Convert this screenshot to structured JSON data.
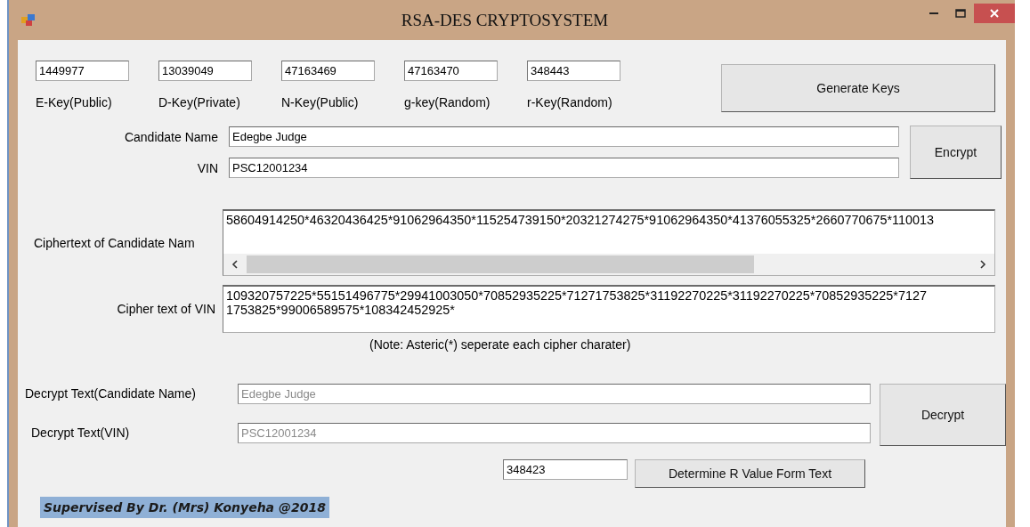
{
  "window": {
    "title": "RSA-DES CRYPTOSYSTEM"
  },
  "keys": [
    {
      "value": "1449977",
      "label": "E-Key(Public)"
    },
    {
      "value": "13039049",
      "label": "D-Key(Private)"
    },
    {
      "value": "47163469",
      "label": "N-Key(Public)"
    },
    {
      "value": "47163470",
      "label": "g-key(Random)"
    },
    {
      "value": "348443",
      "label": "r-Key(Random)"
    }
  ],
  "generate_button": "Generate Keys",
  "inputs": [
    {
      "label": "Candidate Name",
      "value": "Edegbe Judge"
    },
    {
      "label": "VIN",
      "value": "PSC12001234"
    }
  ],
  "encrypt_button": "Encrypt",
  "ciphertexts": [
    {
      "label": "Ciphertext of Candidate Nam",
      "kind": "scrolling",
      "lines": [
        "58604914250*46320436425*91062964350*115254739150*20321274275*91062964350*41376055325*2660770675*110013"
      ]
    },
    {
      "label": "Cipher text of VIN",
      "kind": "wrapped",
      "lines": [
        "109320757225*55151496775*29941003050*70852935225*71271753825*31192270225*31192270225*70852935225*7127",
        "1753825*99006589575*108342452925*"
      ]
    }
  ],
  "note": "(Note: Asteric(*) seperate each cipher charater)",
  "decrypted": [
    {
      "label": "Decrypt Text(Candidate Name)",
      "value": "Edegbe Judge",
      "disabled": true
    },
    {
      "label": "Decrypt Text(VIN)",
      "value": "PSC12001234",
      "disabled": true
    }
  ],
  "decrypt_button": "Decrypt",
  "r_value": "348423",
  "determine_button": "Determine R Value Form Text",
  "footer": "Supervised By Dr. (Mrs) Konyeha @2018"
}
